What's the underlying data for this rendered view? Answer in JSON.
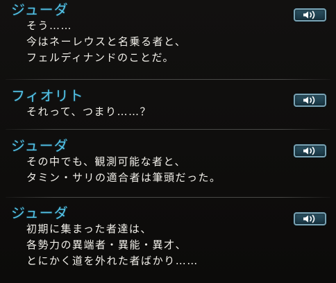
{
  "backlog": {
    "entries": [
      {
        "speaker": "ジューダ",
        "lines": [
          "そう……",
          "今はネーレウスと名乗る者と、",
          "フェルディナンドのことだ。"
        ],
        "voice_icon": "speaker-icon"
      },
      {
        "speaker": "フィオリト",
        "lines": [
          "それって、つまり……？"
        ],
        "voice_icon": "speaker-icon"
      },
      {
        "speaker": "ジューダ",
        "lines": [
          "その中でも、観測可能な者と、",
          "タミン・サリの適合者は筆頭だった。"
        ],
        "voice_icon": "speaker-icon"
      },
      {
        "speaker": "ジューダ",
        "lines": [
          "初期に集まった者達は、",
          "各勢力の異端者・異能・異才、",
          "とにかく道を外れた者ばかり……"
        ],
        "voice_icon": "speaker-icon"
      }
    ]
  },
  "colors": {
    "speaker_name": "#53c4e8",
    "dialogue_text": "#f2f0ea",
    "background": "#0e0d0c",
    "voice_button": "#1f4353"
  }
}
